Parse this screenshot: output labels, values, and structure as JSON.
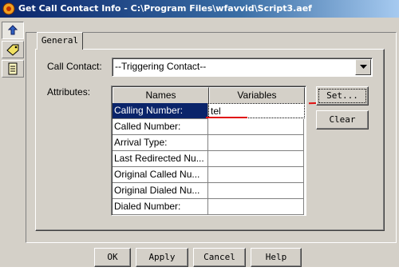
{
  "window": {
    "title": "Get Call Contact Info - C:\\Program Files\\wfavvid\\Script3.aef"
  },
  "sidebar": {
    "icons": [
      "upload-arrow-icon",
      "tag-icon",
      "document-icon"
    ]
  },
  "tabs": [
    {
      "label": "General"
    }
  ],
  "form": {
    "call_contact_label": "Call Contact:",
    "call_contact_value": "--Triggering Contact--",
    "attributes_label": "Attributes:"
  },
  "table": {
    "columns": [
      "Names",
      "Variables"
    ],
    "rows": [
      {
        "name": "Calling Number:",
        "variable": "tel"
      },
      {
        "name": "Called Number:",
        "variable": ""
      },
      {
        "name": "Arrival Type:",
        "variable": ""
      },
      {
        "name": "Last Redirected Nu...",
        "variable": ""
      },
      {
        "name": "Original Called Nu...",
        "variable": ""
      },
      {
        "name": "Original Dialed Nu...",
        "variable": ""
      },
      {
        "name": "Dialed Number:",
        "variable": ""
      }
    ]
  },
  "buttons": {
    "set": "Set...",
    "clear": "Clear",
    "ok": "OK",
    "apply": "Apply",
    "cancel": "Cancel",
    "help": "Help"
  },
  "colors": {
    "title_start": "#0a246a",
    "selection": "#0a246a",
    "annotation": "#e01010"
  }
}
